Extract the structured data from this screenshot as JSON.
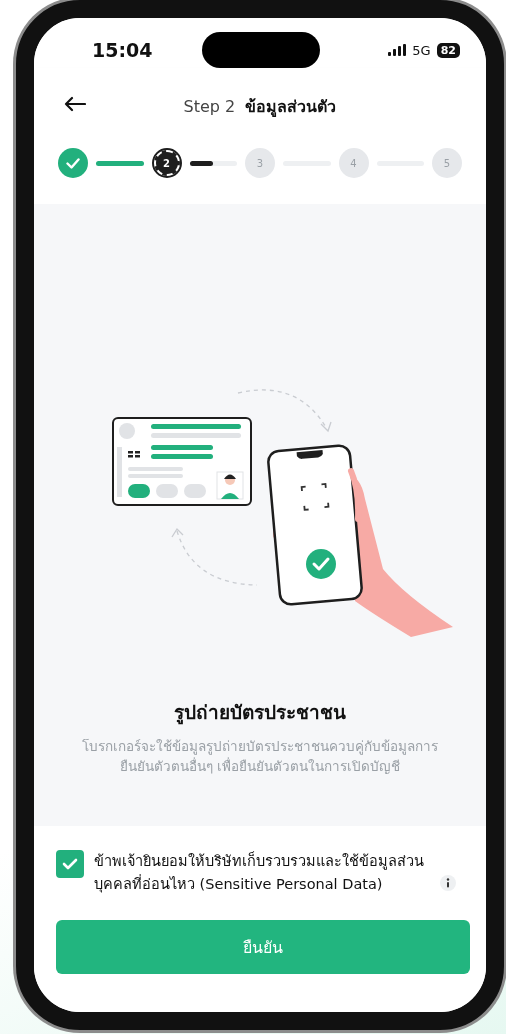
{
  "status_bar": {
    "time": "15:04",
    "network": "5G",
    "battery": "82"
  },
  "header": {
    "title": "Step 2  **ข้อมูลส่วนตัว**"
  },
  "stepper": {
    "steps": [
      {
        "kind": "done"
      },
      {
        "kind": "current",
        "label": "2"
      },
      {
        "kind": "pending",
        "label": "3"
      },
      {
        "kind": "pending",
        "label": "4"
      },
      {
        "kind": "pending",
        "label": "5"
      }
    ],
    "connectors": [
      {
        "level": 1
      },
      {
        "level": 0.5
      },
      {
        "level": 0
      },
      {
        "level": 0
      }
    ]
  },
  "content": {
    "title": "รูปถ่ายบัตรประชาชน",
    "description": "โบรกเกอร์จะใช้ข้อมูลรูปถ่ายบัตรประชาชนควบคู่กับข้อมูลการยืนยันตัวตนอื่นๆ เพื่อยืนยันตัวตนในการเปิดบัญชี"
  },
  "consent": {
    "checked": true,
    "text": "ข้าพเจ้ายินยอมให้บริษัทเก็บรวบรวมและใช้ข้อมูลส่วนบุคคลที่อ่อนไหว (Sensitive Personal Data)"
  },
  "button": {
    "label": "ยืนยัน"
  }
}
